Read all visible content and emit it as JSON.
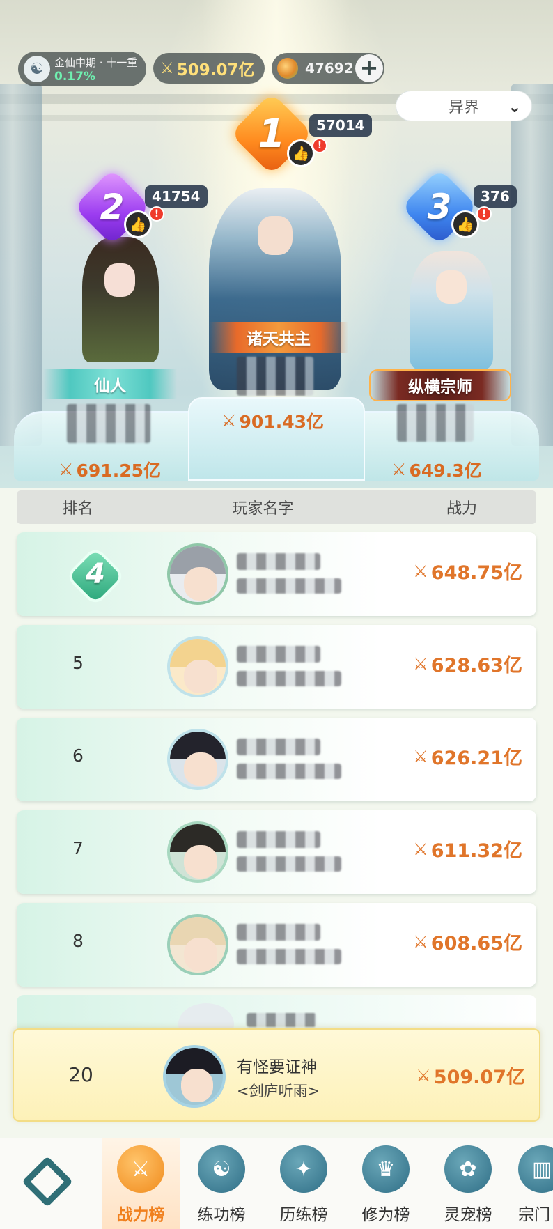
{
  "header": {
    "realm_name": "金仙中期 · 十一重",
    "realm_progress": "0.17%",
    "power": "509.07亿",
    "coins": "47692",
    "add_symbol": "+",
    "realm_filter": "异界"
  },
  "podium": {
    "first": {
      "rank": "1",
      "likes": "57014",
      "title": "诸天共主",
      "power": "901.43亿"
    },
    "second": {
      "rank": "2",
      "likes": "41754",
      "title": "仙人",
      "power": "691.25亿"
    },
    "third": {
      "rank": "3",
      "likes": "376",
      "title": "纵横宗师",
      "power": "649.3亿"
    }
  },
  "table": {
    "headers": {
      "rank": "排名",
      "name": "玩家名字",
      "power": "战力"
    },
    "rows": [
      {
        "rank": "4",
        "power": "648.75亿"
      },
      {
        "rank": "5",
        "power": "628.63亿"
      },
      {
        "rank": "6",
        "power": "626.21亿"
      },
      {
        "rank": "7",
        "power": "611.32亿"
      },
      {
        "rank": "8",
        "power": "608.65亿"
      }
    ]
  },
  "self": {
    "rank": "20",
    "name": "有怪要证神",
    "sect": "<剑庐听雨>",
    "power": "509.07亿"
  },
  "nav": {
    "items": [
      {
        "label": "战力榜",
        "icon": "crossed-swords-icon"
      },
      {
        "label": "练功榜",
        "icon": "yin-yang-icon"
      },
      {
        "label": "历练榜",
        "icon": "star-ring-icon"
      },
      {
        "label": "修为榜",
        "icon": "hat-icon"
      },
      {
        "label": "灵宠榜",
        "icon": "pet-icon"
      },
      {
        "label": "宗门",
        "icon": "sect-icon"
      }
    ]
  },
  "colors": {
    "accent": "#e0752a",
    "tab_active": "#f0801e",
    "progress": "#6ff0b0"
  }
}
